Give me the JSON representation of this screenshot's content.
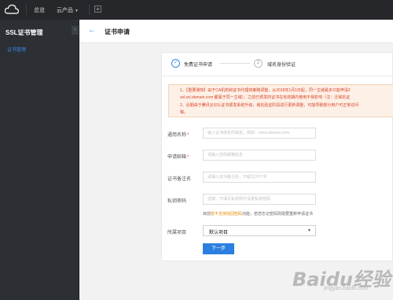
{
  "topbar": {
    "nav_overview": "总览",
    "nav_products": "云产品",
    "plus": "+"
  },
  "sidebar": {
    "title": "SSL证书管理",
    "collapse_icon": "‹",
    "items": [
      {
        "label": "证书管理",
        "active": true
      }
    ]
  },
  "page": {
    "back_icon": "←",
    "title": "证书申请"
  },
  "steps": [
    {
      "number": "✓",
      "label": "免费证书申请",
      "state": "active"
    },
    {
      "number": "2",
      "label": "域名身份验证",
      "state": "pending"
    }
  ],
  "notice": {
    "line1": "1、【重要通知】由于CA机构和证书代理商策略调整，从2018年1月1日起，同一主域最多只能申请2",
    "line2": "ssl.ssl.domain.com 都属于同一主域）。之前已颁发的证书在有效期内使用不受影响（注：泛域名证",
    "line3": "2、近期由于腾讯云SSL证书颁发系统升级，域名验证阶段进行更新调整，可能导致部分用户可正常访问",
    "line4": "稿。"
  },
  "form": {
    "domain": {
      "label": "通用名称",
      "required": "*",
      "placeholder": "输入证书绑定的域名，例如：www.domain.com",
      "value": ""
    },
    "email": {
      "label": "申请邮箱",
      "required": "*",
      "placeholder": "请输入您的邮箱信息",
      "value": ""
    },
    "remark": {
      "label": "证书备注名",
      "placeholder": "请输入证书备注名，不超过20个字",
      "value": ""
    },
    "password": {
      "label": "私钥密码",
      "placeholder": "选填，不填写私钥则不设置私钥密码",
      "value": ""
    },
    "hint_prefix": "目前",
    "hint_link": "暂不支持找回密码",
    "hint_suffix": "功能，若您忘记密码则需要重新申请证书",
    "project": {
      "label": "所属项目",
      "value": "默认项目"
    },
    "next_button": "下一步"
  },
  "watermark": {
    "text": "Baidu经验",
    "sub": "jingyan.baidu.com"
  },
  "colors": {
    "accent": "#2a7fe0",
    "topbar": "#25272b",
    "sidebar": "#2c2f34",
    "notice_bg": "#fdf0e6",
    "notice_text": "#d9452a"
  }
}
